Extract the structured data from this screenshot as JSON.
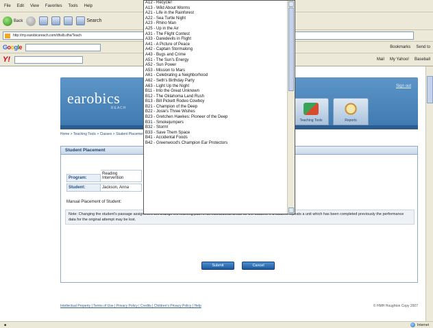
{
  "browser": {
    "menu": [
      "File",
      "Edit",
      "View",
      "Favorites",
      "Tools",
      "Help"
    ],
    "toolbar": {
      "back_label": "Back",
      "search_label": "Search"
    },
    "address": "http://my.earobicsreach.com/dhslb.dhs/Teach",
    "google_label": "Google",
    "yahoo_label": "Y!",
    "right_tools": [
      "Bookmarks",
      "Send to",
      "Mail",
      "My Yahoo!",
      "Baseball"
    ],
    "status_right": "Internet"
  },
  "app": {
    "logo": "earobics",
    "logo_sub": "REACH",
    "signout": "Sign out",
    "tabs": [
      {
        "label": "Teaching Tools",
        "active": true
      },
      {
        "label": "Reports",
        "active": false
      }
    ],
    "breadcrumb": "Home > Teaching Tools > Classes > Student Placement",
    "panel_title": "Student Placement",
    "fields": [
      {
        "key": "Program:",
        "value": "Reading Intervention"
      },
      {
        "key": "Student:",
        "value": "Jackson, Anna"
      }
    ],
    "manual_label": "Manual Placement of Student:",
    "note": "Note: Changing the student's passage assignment will change the learning path in all instructional areas for the student. If a student repeats a unit which has been completed previously the performance data for the original attempt may be lost.",
    "submit_label": "Submit",
    "cancel_label": "Cancel",
    "footer_links": "Intellectual Property | Terms of Use | Privacy Policy | Credits | Children's Privacy Policy | Help",
    "copyright": "© HMH Houghton Copy 2007"
  },
  "dropdown": {
    "selected_index": 29,
    "items": [
      "A12 - Recycle!",
      "A13 - Wild About Worms",
      "A21 - Life in the Rainforest",
      "A22 - Sea Turtle Night",
      "A23 - Rhino Man",
      "A25 - Up in the Air",
      "A31 - The Flight Contest",
      "A33 - Daredevils in Flight",
      "A41 - A Picture of Peace",
      "A42 - Captain Stormalong",
      "A43 - Bugs and Crime",
      "A51 - The Sun's Energy",
      "A52 - Sun Power",
      "A53 - Mission to Mars",
      "A61 - Celebrating a Neighborhood",
      "A62 - Seth's Birthday Party",
      "A63 - Light Up the Night",
      "B11 - Into the Great Unknown",
      "B12 - The Oklahoma Land Rush",
      "B13 - Bill Pickett Rodeo Cowboy",
      "B21 - Champion of the Deep",
      "B22 - Josie's Three Wishes",
      "B23 - Gretchen Hawkes: Pioneer of the Deep",
      "B31 - Smokejumpers",
      "B32 - Storm!",
      "B33 - Save Them Space",
      "B41 - Accidental Foods",
      "B42 - Greenwood's Champion Ear Protectors"
    ]
  }
}
